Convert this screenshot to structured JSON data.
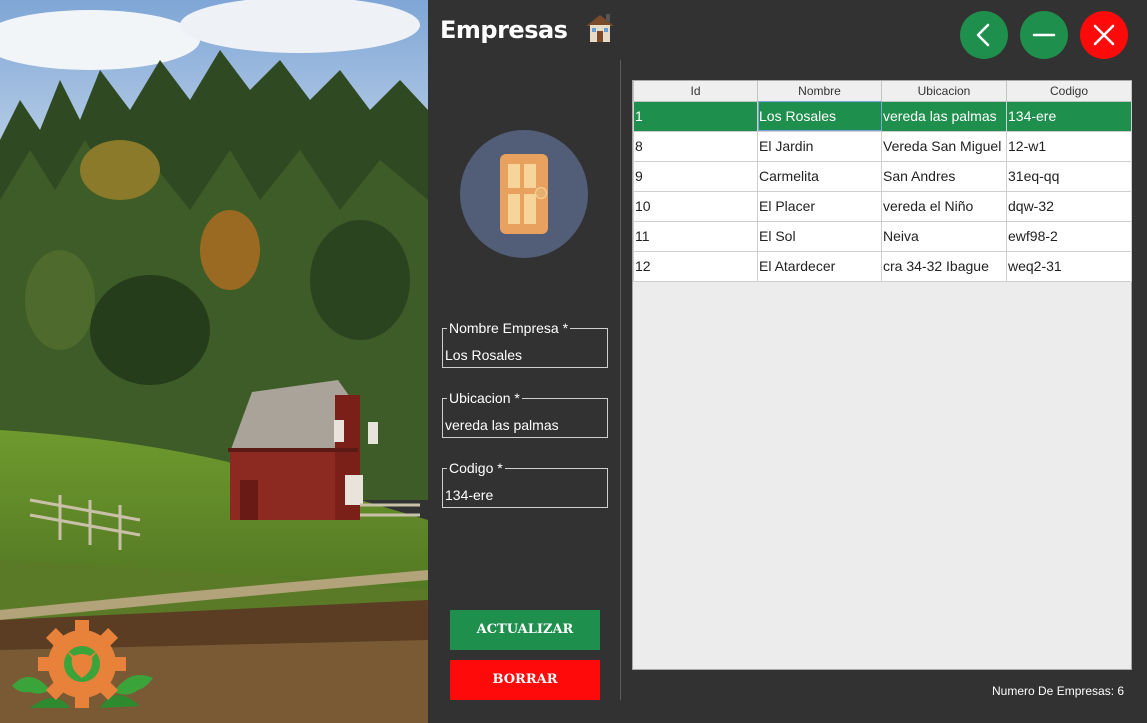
{
  "header": {
    "title": "Empresas"
  },
  "window_controls": {
    "back": "chevron-left-icon",
    "minimize": "minus-icon",
    "close": "close-icon"
  },
  "form": {
    "nombre": {
      "label": "Nombre Empresa *",
      "value": "Los Rosales"
    },
    "ubicacion": {
      "label": "Ubicacion *",
      "value": "vereda las palmas"
    },
    "codigo": {
      "label": "Codigo *",
      "value": "134-ere"
    }
  },
  "actions": {
    "update_label": "ACTUALIZAR",
    "delete_label": "BORRAR"
  },
  "table": {
    "columns": [
      "Id",
      "Nombre",
      "Ubicacion",
      "Codigo"
    ],
    "rows": [
      [
        "1",
        "Los Rosales",
        "vereda las palmas",
        "134-ere"
      ],
      [
        "8",
        "El Jardin",
        "Vereda San Miguel",
        "12-w1"
      ],
      [
        "9",
        "Carmelita",
        "San Andres",
        "31eq-qq"
      ],
      [
        "10",
        "El Placer",
        "vereda el Niño",
        "dqw-32"
      ],
      [
        "11",
        "El Sol",
        "Neiva",
        "ewf98-2"
      ],
      [
        "12",
        "El Atardecer",
        "cra 34-32 Ibague",
        "weq2-31"
      ]
    ],
    "selected_row": 0
  },
  "footer": {
    "count_text": "Numero De Empresas: 6"
  },
  "colors": {
    "accent_green": "#1e8f4c",
    "danger_red": "#ff0a0a",
    "panel_bg": "#323232",
    "avatar_bg": "#525e78",
    "door": "#e8a15f"
  }
}
